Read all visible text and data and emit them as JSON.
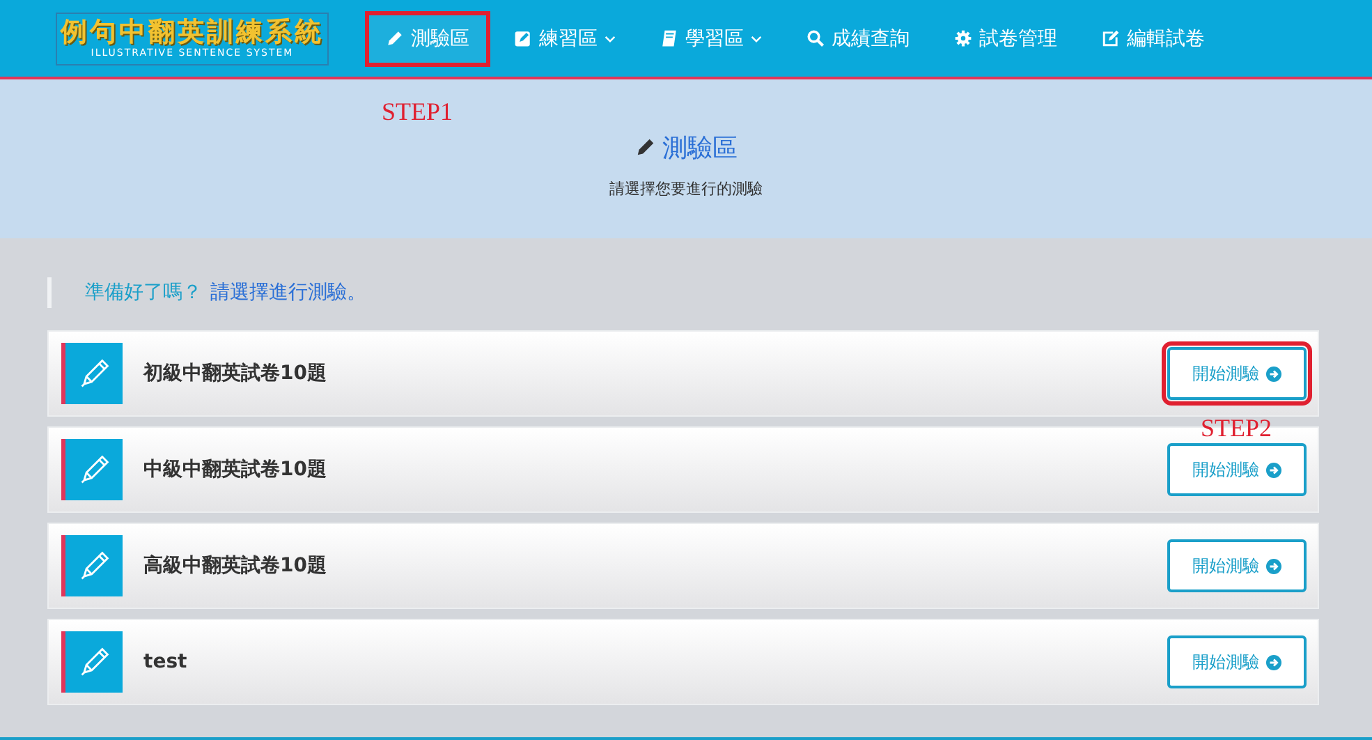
{
  "logo": {
    "title": "例句中翻英訓練系統",
    "subtitle": "ILLUSTRATIVE SENTENCE SYSTEM"
  },
  "nav": [
    {
      "label": "測驗區",
      "selected": true,
      "dropdown": false,
      "step": "STEP1"
    },
    {
      "label": "練習區",
      "selected": false,
      "dropdown": true
    },
    {
      "label": "學習區",
      "selected": false,
      "dropdown": true
    },
    {
      "label": "成績查詢",
      "selected": false,
      "dropdown": false
    },
    {
      "label": "試卷管理",
      "selected": false,
      "dropdown": false
    },
    {
      "label": "編輯試卷",
      "selected": false,
      "dropdown": false
    }
  ],
  "header": {
    "title": "測驗區",
    "subtitle": "請選擇您要進行的測驗"
  },
  "callout": {
    "question": "準備好了嗎？",
    "prompt": "請選擇進行測驗。"
  },
  "quizzes": [
    {
      "title": "初級中翻英試卷10題",
      "button": "開始測驗",
      "step": "STEP2"
    },
    {
      "title": "中級中翻英試卷10題",
      "button": "開始測驗"
    },
    {
      "title": "高級中翻英試卷10題",
      "button": "開始測驗"
    },
    {
      "title": "test",
      "button": "開始測驗"
    }
  ]
}
